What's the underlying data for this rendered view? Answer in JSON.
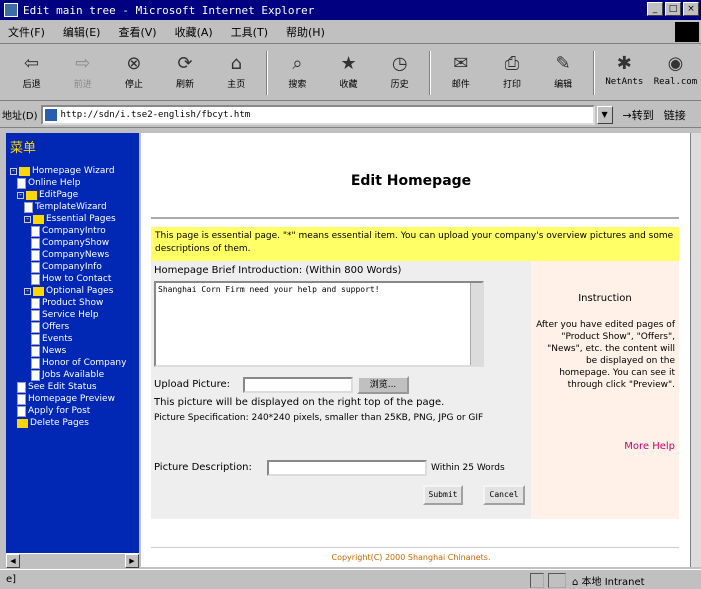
{
  "window": {
    "title": "Edit main tree - Microsoft Internet Explorer"
  },
  "menu": [
    "文件(F)",
    "编辑(E)",
    "查看(V)",
    "收藏(A)",
    "工具(T)",
    "帮助(H)"
  ],
  "toolbar": [
    {
      "label": "后退",
      "icon": "back-arrow-icon",
      "disabled": false
    },
    {
      "label": "前进",
      "icon": "forward-arrow-icon",
      "disabled": true
    },
    {
      "label": "停止",
      "icon": "stop-icon",
      "disabled": false
    },
    {
      "label": "刷新",
      "icon": "refresh-icon",
      "disabled": false
    },
    {
      "label": "主页",
      "icon": "home-icon",
      "disabled": false
    },
    {
      "label": "搜索",
      "icon": "search-icon",
      "disabled": false
    },
    {
      "label": "收藏",
      "icon": "favorites-icon",
      "disabled": false
    },
    {
      "label": "历史",
      "icon": "history-icon",
      "disabled": false
    },
    {
      "label": "邮件",
      "icon": "mail-icon",
      "disabled": false
    },
    {
      "label": "打印",
      "icon": "print-icon",
      "disabled": false
    },
    {
      "label": "编辑",
      "icon": "edit-icon",
      "disabled": false
    },
    {
      "label": "NetAnts",
      "icon": "netants-icon",
      "disabled": false
    },
    {
      "label": "Real.com",
      "icon": "real-icon",
      "disabled": false
    }
  ],
  "address": {
    "label": "地址(D)",
    "url": "http://sdn/i.tse2-english/fbcyt.htm",
    "go_label": "转到",
    "links_label": "链接"
  },
  "tree": {
    "header": "菜单",
    "nodes": [
      {
        "label": "Homepage Wizard",
        "kind": "folder",
        "expanded": true
      },
      {
        "label": "Online Help",
        "kind": "doc"
      },
      {
        "label": "EditPage",
        "kind": "folder",
        "expanded": true
      },
      {
        "label": "TemplateWizard",
        "kind": "doc"
      },
      {
        "label": "Essential Pages",
        "kind": "folder",
        "expanded": true
      },
      {
        "label": "CompanyIntro",
        "kind": "doc"
      },
      {
        "label": "CompanyShow",
        "kind": "doc"
      },
      {
        "label": "CompanyNews",
        "kind": "doc"
      },
      {
        "label": "CompanyInfo",
        "kind": "doc"
      },
      {
        "label": "How to Contact",
        "kind": "doc"
      },
      {
        "label": "Optional Pages",
        "kind": "folder",
        "expanded": true
      },
      {
        "label": "Product Show",
        "kind": "doc"
      },
      {
        "label": "Service Help",
        "kind": "doc"
      },
      {
        "label": "Offers",
        "kind": "doc"
      },
      {
        "label": "Events",
        "kind": "doc"
      },
      {
        "label": "News",
        "kind": "doc"
      },
      {
        "label": "Honor of Company",
        "kind": "doc"
      },
      {
        "label": "Jobs Available",
        "kind": "doc"
      },
      {
        "label": "See Edit Status",
        "kind": "doc"
      },
      {
        "label": "Homepage Preview",
        "kind": "doc"
      },
      {
        "label": "Apply for Post",
        "kind": "doc"
      },
      {
        "label": "Delete Pages",
        "kind": "folder"
      }
    ]
  },
  "page": {
    "title": "Edit Homepage",
    "notice": "This page is essential page. \"*\" means essential item. You can upload your company's overview pictures and some descriptions of them.",
    "brief_label": "Homepage Brief Introduction:   (Within 800 Words)",
    "brief_value": "Shanghai Corn Firm need your help and support!",
    "upload_label": "Upload Picture:",
    "browse_label": "浏览...",
    "upload_note": "This picture will be displayed on the right top of the page.",
    "upload_spec": "Picture Specification: 240*240 pixels, smaller than 25KB, PNG, JPG or GIF",
    "desc_label": "Picture Description:",
    "desc_limit": "Within 25 Words",
    "submit_label": "Submit",
    "cancel_label": "Cancel",
    "instruction_title": "Instruction",
    "instruction_body": "After you have edited pages of \"Product Show\", \"Offers\", \"News\", etc. the content will be displayed on the homepage. You can see it through click \"Preview\".",
    "more_help": "More Help",
    "copyright": "Copyright(C) 2000 Shanghai Chinanets."
  },
  "status": {
    "zone": "本地 Intranet"
  },
  "colors": {
    "titlebar": "#000080",
    "tree_bg": "#0028b4",
    "notice_bg": "#ffff66",
    "more_help": "#cc0066"
  }
}
